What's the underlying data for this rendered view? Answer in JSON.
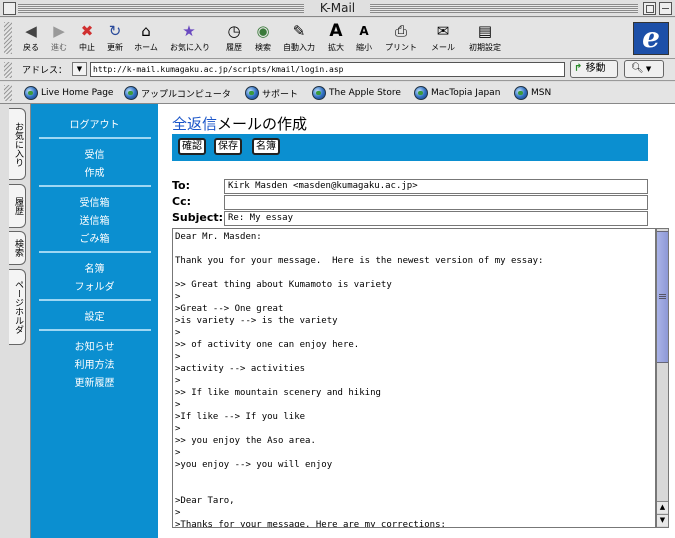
{
  "window": {
    "title": "K-Mail"
  },
  "toolbar": {
    "buttons": [
      {
        "icon": "back-arrow-icon",
        "glyph": "◀",
        "label": "戻る"
      },
      {
        "icon": "forward-arrow-icon",
        "glyph": "▶",
        "label": "進む"
      },
      {
        "icon": "stop-icon",
        "glyph": "✖",
        "label": "中止"
      },
      {
        "icon": "refresh-icon",
        "glyph": "↻",
        "label": "更新"
      },
      {
        "icon": "home-icon",
        "glyph": "⌂",
        "label": "ホーム"
      },
      {
        "icon": "favorites-icon",
        "glyph": "★",
        "label": "お気に入り"
      },
      {
        "icon": "history-icon",
        "glyph": "◷",
        "label": "履歴"
      },
      {
        "icon": "search-icon",
        "glyph": "◉",
        "label": "検索"
      },
      {
        "icon": "autofill-icon",
        "glyph": "✎",
        "label": "自動入力"
      },
      {
        "icon": "text-larger-icon",
        "glyph": "A",
        "label": "拡大"
      },
      {
        "icon": "text-smaller-icon",
        "glyph": "A",
        "label": "縮小"
      },
      {
        "icon": "print-icon",
        "glyph": "⎙",
        "label": "プリント"
      },
      {
        "icon": "mail-icon",
        "glyph": "✉",
        "label": "メール"
      },
      {
        "icon": "preferences-icon",
        "glyph": "▤",
        "label": "初期設定"
      }
    ]
  },
  "address": {
    "label": "アドレス：",
    "url": "http://k-mail.kumagaku.ac.jp/scripts/kmail/login.asp",
    "go_label": "移動"
  },
  "favorites": [
    "Live Home Page",
    "アップルコンピュータ",
    "サポート",
    "The Apple Store",
    "MacTopia Japan",
    "MSN"
  ],
  "explorer_tabs": [
    "お気に入り",
    "履歴",
    "検索",
    "ページホルダ"
  ],
  "sidebar": {
    "logout": "ログアウト",
    "group1": [
      "受信",
      "作成"
    ],
    "group2": [
      "受信箱",
      "送信箱",
      "ごみ箱"
    ],
    "group3": [
      "名簿",
      "フォルダ"
    ],
    "group4": [
      "設定"
    ],
    "group5": [
      "お知らせ",
      "利用方法",
      "更新履歴"
    ]
  },
  "compose": {
    "title_highlight": "全返信",
    "title_rest": "メールの作成",
    "buttons": [
      "確認",
      "保存",
      "名簿"
    ],
    "to_label": "To:",
    "to_value": "Kirk Masden <masden@kumagaku.ac.jp>",
    "cc_label": "Cc:",
    "cc_value": "",
    "subject_label": "Subject:",
    "subject_value": "Re: My essay",
    "body": "Dear Mr. Masden:\n\nThank you for your message.  Here is the newest version of my essay:\n\n>> Great thing about Kumamoto is variety\n>\n>Great --> One great\n>is variety --> is the variety\n>\n>> of activity one can enjoy here.\n>\n>activity --> activities\n>\n>> If like mountain scenery and hiking\n>\n>If like --> If you like\n>\n>> you enjoy the Aso area.\n>\n>you enjoy --> you will enjoy\n\n\n>Dear Taro,\n>\n>Thanks for your message. Here are my corrections:"
  }
}
